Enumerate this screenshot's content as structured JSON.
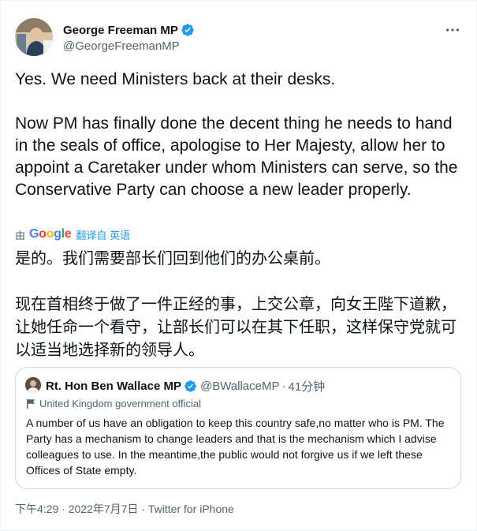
{
  "author": {
    "name": "George Freeman MP",
    "handle": "@GeorgeFreemanMP"
  },
  "tweet": {
    "paragraphs": [
      "Yes. We need Ministers back at their desks.",
      "Now PM has finally done the decent thing he needs to hand in the seals of office, apologise to Her Majesty, allow her to appoint a Caretaker under whom Ministers can serve, so the Conservative Party can choose a new leader properly."
    ]
  },
  "translation": {
    "by_label": "由",
    "provider": "Google",
    "label": "翻译自 英语",
    "paragraphs": [
      "是的。我们需要部长们回到他们的办公桌前。",
      "现在首相终于做了一件正经的事，上交公章，向女王陛下道歉，让她任命一个看守，让部长们可以在其下任职，这样保守党就可以适当地选择新的领导人。"
    ]
  },
  "quoted": {
    "name": "Rt. Hon Ben Wallace MP",
    "handle": "@BWallaceMP",
    "separator": "·",
    "time": "41分钟",
    "label": "United Kingdom government official",
    "text": "A number of us have an obligation to keep this country safe,no matter who is PM. The Party has a mechanism to change leaders and that is the mechanism which I advise colleagues to use. In the meantime,the public would not forgive us if we left these Offices of State empty."
  },
  "meta": {
    "time": "下午4:29",
    "sep1": " · ",
    "date": "2022年7月7日",
    "sep2": " · ",
    "source": "Twitter for iPhone"
  },
  "colors": {
    "accent": "#1d9bf0",
    "text": "#0f1419",
    "secondary": "#536471",
    "border": "#cfd9de"
  },
  "icons": [
    "verified-badge-icon",
    "more-icon",
    "government-flag-icon"
  ]
}
